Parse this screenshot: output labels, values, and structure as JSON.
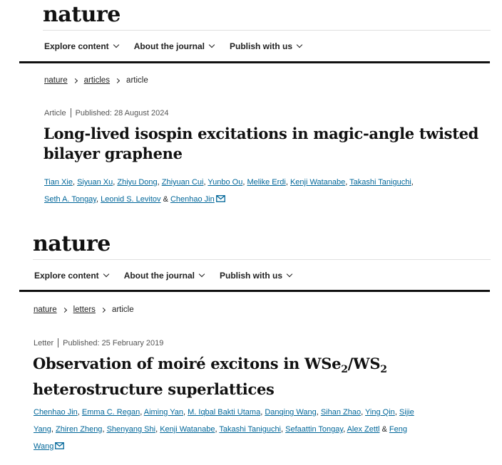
{
  "panel1": {
    "logo": "nature",
    "nav": [
      "Explore content",
      "About the journal",
      "Publish with us"
    ],
    "breadcrumb": {
      "home": "nature",
      "section": "articles",
      "current": "article"
    },
    "article_type": "Article",
    "published": "Published: 28 August 2024",
    "title_line1": "Long-lived isospin excitations in magic-angle twisted",
    "title_line2": "bilayer graphene",
    "authors": [
      "Tian Xie",
      "Siyuan Xu",
      "Zhiyu Dong",
      "Zhiyuan Cui",
      "Yunbo Ou",
      "Melike Erdi",
      "Kenji Watanabe",
      "Takashi Taniguchi",
      "Seth A. Tongay",
      "Leonid S. Levitov",
      "Chenhao Jin"
    ],
    "and": "&"
  },
  "panel2": {
    "logo": "nature",
    "nav": [
      "Explore content",
      "About the journal",
      "Publish with us"
    ],
    "breadcrumb": {
      "home": "nature",
      "section": "letters",
      "current": "article"
    },
    "article_type": "Letter",
    "published": "Published: 25 February 2019",
    "title_a": "Observation of moiré excitons in WSe",
    "sub": "2",
    "slash_ws": "/WS",
    "title_line2": "heterostructure superlattices",
    "authors": [
      "Chenhao Jin",
      "Emma C. Regan",
      "Aiming Yan",
      "M. Iqbal Bakti Utama",
      "Danqing Wang",
      "Sihan Zhao",
      "Ying Qin",
      "Sijie",
      "Yang",
      "Zhiren Zheng",
      "Shenyang Shi",
      "Kenji Watanabe",
      "Takashi Taniguchi",
      "Sefaattin Tongay",
      "Alex Zettl",
      "Feng",
      "Wang"
    ],
    "and": "&"
  }
}
